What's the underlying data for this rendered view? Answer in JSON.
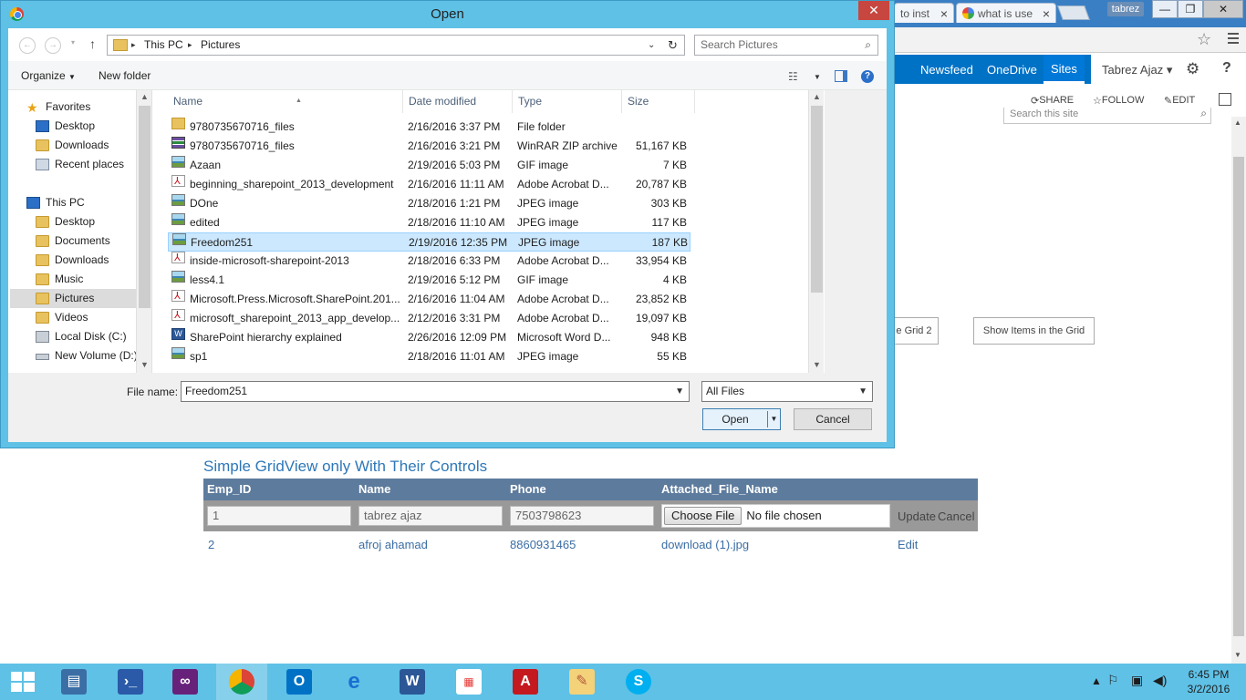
{
  "browser": {
    "tabs": [
      {
        "title": "to inst"
      },
      {
        "title": "what is use"
      }
    ],
    "profile": "tabrez",
    "controls": {
      "minimize": "—",
      "restore": "❐",
      "close": "✕"
    }
  },
  "sharepoint": {
    "nav": {
      "newsfeed": "Newsfeed",
      "onedrive": "OneDrive",
      "sites": "Sites"
    },
    "user": "Tabrez Ajaz",
    "actions": {
      "share": "SHARE",
      "follow": "FOLLOW",
      "edit": "EDIT"
    },
    "search_placeholder": "Search this site",
    "buttons": {
      "grid2": "e Grid 2",
      "show_items": "Show Items in the Grid"
    }
  },
  "gridview": {
    "title": "Simple GridView only With Their Controls",
    "headers": [
      "Emp_ID",
      "Name",
      "Phone",
      "Attached_File_Name"
    ],
    "edit_row": {
      "emp_id": "1",
      "name": "tabrez ajaz",
      "phone": "7503798623",
      "choose_file": "Choose File",
      "no_file": "No file chosen",
      "update": "Update",
      "cancel": "Cancel"
    },
    "row2": {
      "emp_id": "2",
      "name": "afroj ahamad",
      "phone": "8860931465",
      "file": "download (1).jpg",
      "edit": "Edit"
    }
  },
  "dialog": {
    "title": "Open",
    "address": {
      "root": "This PC",
      "folder": "Pictures"
    },
    "search_placeholder": "Search Pictures",
    "toolbar": {
      "organize": "Organize",
      "new_folder": "New folder"
    },
    "nav_pane": {
      "favorites": "Favorites",
      "fav_items": [
        "Desktop",
        "Downloads",
        "Recent places"
      ],
      "this_pc": "This PC",
      "pc_items": [
        "Desktop",
        "Documents",
        "Downloads",
        "Music",
        "Pictures",
        "Videos",
        "Local Disk (C:)",
        "New Volume (D:)"
      ]
    },
    "columns": {
      "name": "Name",
      "date": "Date modified",
      "type": "Type",
      "size": "Size"
    },
    "files": [
      {
        "name": "9780735670716_files",
        "date": "2/16/2016 3:37 PM",
        "type": "File folder",
        "size": "",
        "icon": "folder-icon"
      },
      {
        "name": "9780735670716_files",
        "date": "2/16/2016 3:21 PM",
        "type": "WinRAR ZIP archive",
        "size": "51,167 KB",
        "icon": "rar-icon"
      },
      {
        "name": "Azaan",
        "date": "2/19/2016 5:03 PM",
        "type": "GIF image",
        "size": "7 KB",
        "icon": "image-icon"
      },
      {
        "name": "beginning_sharepoint_2013_development",
        "date": "2/16/2016 11:11 AM",
        "type": "Adobe Acrobat D...",
        "size": "20,787 KB",
        "icon": "pdf-icon"
      },
      {
        "name": "DOne",
        "date": "2/18/2016 1:21 PM",
        "type": "JPEG image",
        "size": "303 KB",
        "icon": "image-icon"
      },
      {
        "name": "edited",
        "date": "2/18/2016 11:10 AM",
        "type": "JPEG image",
        "size": "117 KB",
        "icon": "image-icon"
      },
      {
        "name": "Freedom251",
        "date": "2/19/2016 12:35 PM",
        "type": "JPEG image",
        "size": "187 KB",
        "icon": "image-icon",
        "selected": true
      },
      {
        "name": "inside-microsoft-sharepoint-2013",
        "date": "2/18/2016 6:33 PM",
        "type": "Adobe Acrobat D...",
        "size": "33,954 KB",
        "icon": "pdf-icon"
      },
      {
        "name": "less4.1",
        "date": "2/19/2016 5:12 PM",
        "type": "GIF image",
        "size": "4 KB",
        "icon": "image-icon"
      },
      {
        "name": "Microsoft.Press.Microsoft.SharePoint.201...",
        "date": "2/16/2016 11:04 AM",
        "type": "Adobe Acrobat D...",
        "size": "23,852 KB",
        "icon": "pdf-icon"
      },
      {
        "name": "microsoft_sharepoint_2013_app_develop...",
        "date": "2/12/2016 3:31 PM",
        "type": "Adobe Acrobat D...",
        "size": "19,097 KB",
        "icon": "pdf-icon"
      },
      {
        "name": "SharePoint hierarchy explained",
        "date": "2/26/2016 12:09 PM",
        "type": "Microsoft Word D...",
        "size": "948 KB",
        "icon": "word-icon"
      },
      {
        "name": "sp1",
        "date": "2/18/2016 11:01 AM",
        "type": "JPEG image",
        "size": "55 KB",
        "icon": "image-icon"
      }
    ],
    "file_name_label": "File name:",
    "file_name_value": "Freedom251",
    "filter": "All Files",
    "open_button": "Open",
    "cancel_button": "Cancel"
  },
  "taskbar": {
    "clock_time": "6:45 PM",
    "clock_date": "3/2/2016"
  }
}
